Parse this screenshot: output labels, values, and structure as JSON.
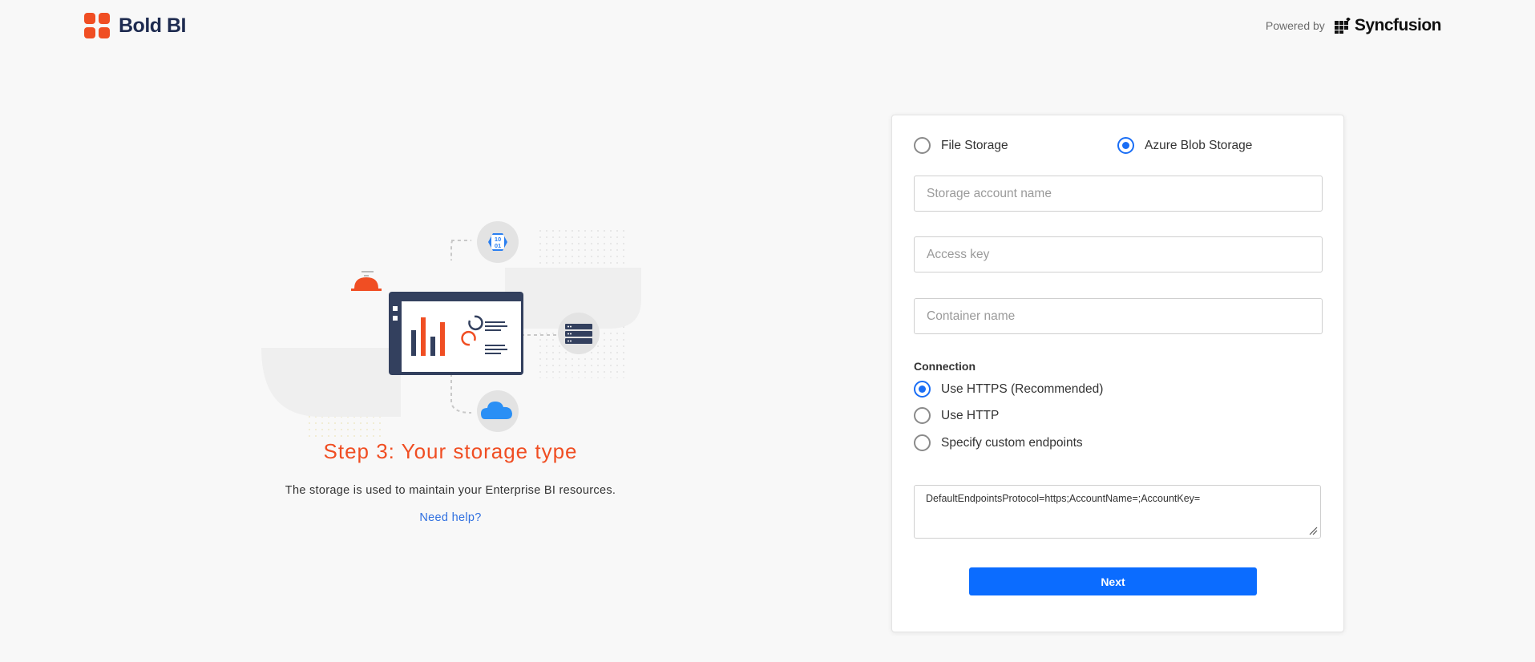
{
  "header": {
    "brand_name": "Bold BI",
    "powered_by_label": "Powered by",
    "partner_name": "Syncfusion"
  },
  "intro": {
    "title": "Step 3: Your storage type",
    "description": "The storage is used to maintain your Enterprise BI resources.",
    "help_link": "Need help?",
    "binary_badge_lines": [
      "10",
      "01"
    ]
  },
  "form": {
    "storage_types": [
      {
        "label": "File Storage",
        "selected": false
      },
      {
        "label": "Azure Blob Storage",
        "selected": true
      }
    ],
    "fields": {
      "account_name_placeholder": "Storage account name",
      "access_key_placeholder": "Access key",
      "container_placeholder": "Container name"
    },
    "connection": {
      "label": "Connection",
      "options": [
        {
          "label": "Use HTTPS (Recommended)",
          "selected": true
        },
        {
          "label": "Use HTTP",
          "selected": false
        },
        {
          "label": "Specify custom endpoints",
          "selected": false
        }
      ],
      "connection_string": "DefaultEndpointsProtocol=https;AccountName=;AccountKey="
    },
    "next_label": "Next"
  },
  "colors": {
    "brand_orange": "#f04e23",
    "primary_blue": "#0b6cff",
    "navy": "#1e2b50"
  }
}
